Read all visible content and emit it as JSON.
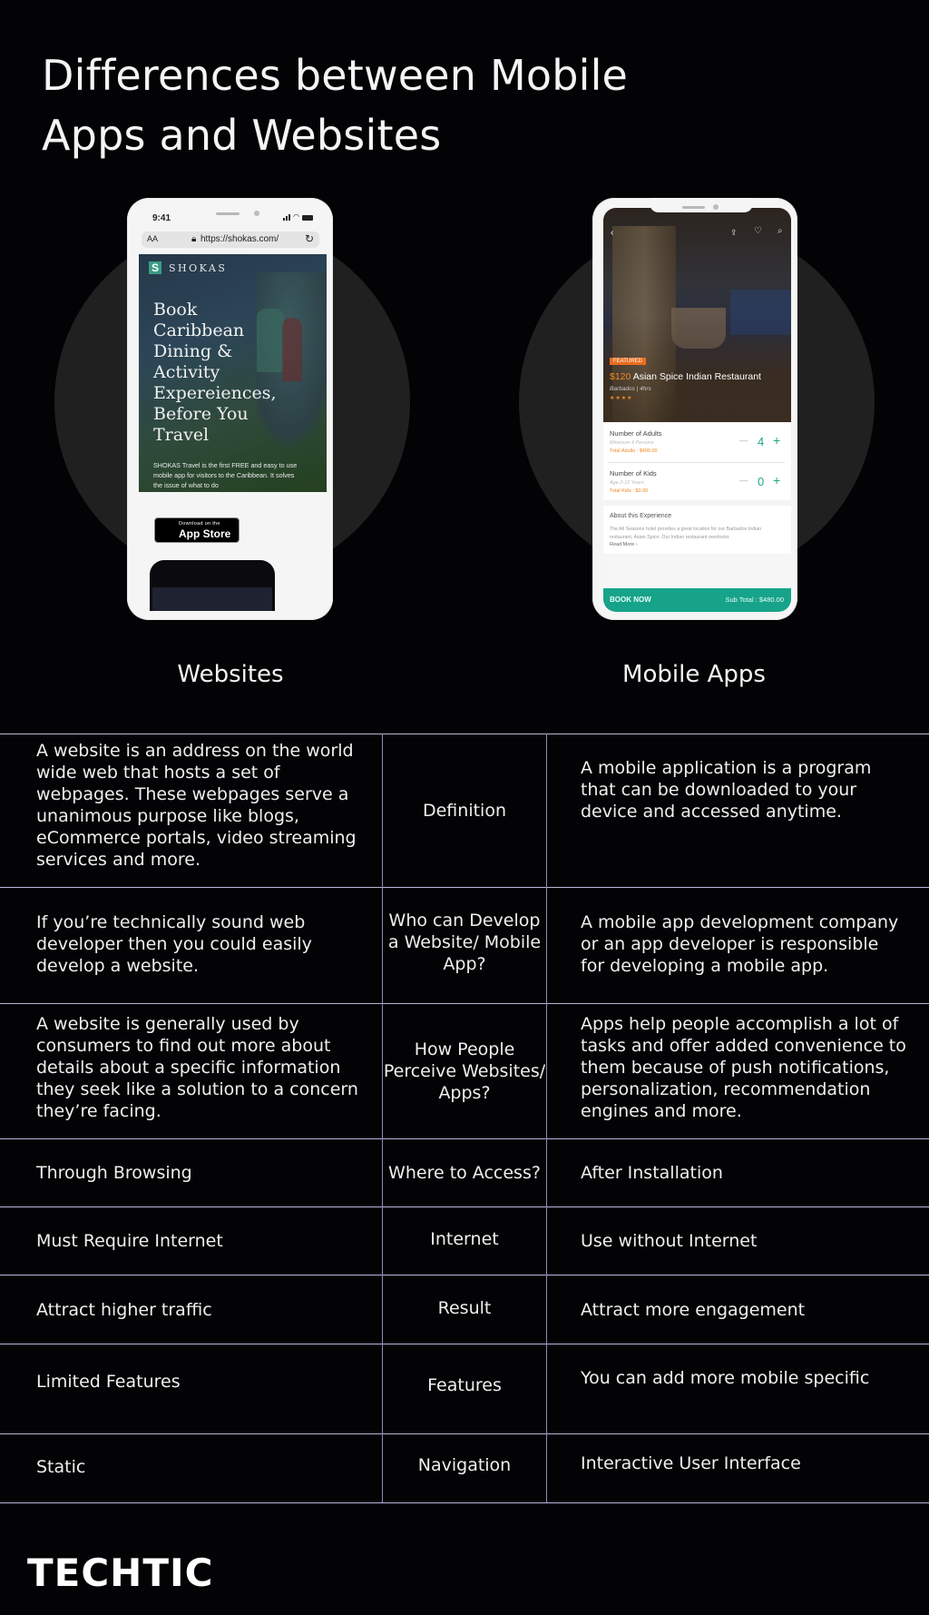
{
  "title": {
    "line1": "Differences between Mobile",
    "line2": "Apps and Websites"
  },
  "website_phone": {
    "time": "9:41",
    "text_size_label": "AA",
    "url": "https://shokas.com/",
    "brand": "SHOKAS",
    "brand_letter": "S",
    "headline_lines": [
      "Book",
      "Caribbean",
      "Dining &",
      "Activity",
      "Expereiences,",
      "Before You",
      "Travel"
    ],
    "description": "SHOKAS Travel is the first FREE and easy to use mobile app for visitors to the Caribbean. It solves the issue of what to do",
    "app_store_small": "Download on the",
    "app_store_big": "App Store"
  },
  "app_phone": {
    "badge": "FEATURED",
    "price": "$120",
    "restaurant": "Asian Spice Indian Restaurant",
    "location": "Barbados",
    "duration": "4hrs",
    "rating_stars": 4,
    "adults": {
      "label": "Number of Adults",
      "sub": "Minimum 4 Persons",
      "total": "Total Adults : $480.00",
      "value": "4"
    },
    "kids": {
      "label": "Number of Kids",
      "sub": "Age 2-12 Years",
      "total": "Total Kids : $0.00",
      "value": "0"
    },
    "about_title": "About this Experience",
    "about_text": "The All Seasons hotel provides a great location for our Barbados Indian restaurant, Asian Spice. Our Indian restaurant overlooks",
    "read_more": "Read More",
    "book_now": "BOOK NOW",
    "sub_total": "Sub Total : $480.00",
    "minus": "—",
    "plus": "+"
  },
  "columns": {
    "left": "Websites",
    "right": "Mobile Apps"
  },
  "rows": [
    {
      "website": "A website is an address on the world wide web that hosts a set of webpages. These webpages serve a unanimous purpose like blogs, eCommerce portals, video streaming services and more.",
      "aspect": "Definition",
      "app": "A mobile application is a program that can be downloaded to your device and accessed anytime."
    },
    {
      "website": "If you’re technically sound web developer then you could easily develop a website.",
      "aspect": "Who can Develop a Website/ Mobile App?",
      "app": "A mobile app development company or an app developer is responsible for developing a mobile app."
    },
    {
      "website": "A website is generally used by consumers to find out more about details about a specific information they seek like a solution to a concern they’re facing.",
      "aspect": "How People Perceive Websites/ Apps?",
      "app": "Apps help people accomplish a lot of tasks and offer added convenience to them because of push notifications, personalization, recommendation engines and more."
    },
    {
      "website": "Through Browsing",
      "aspect": "Where to Access?",
      "app": "After Installation"
    },
    {
      "website": "Must Require Internet",
      "aspect": "Internet",
      "app": "Use without Internet"
    },
    {
      "website": "Attract higher traffic",
      "aspect": "Result",
      "app": "Attract more engagement"
    },
    {
      "website": "Limited Features",
      "aspect": "Features",
      "app": "You can add more mobile specific"
    },
    {
      "website": "Static",
      "aspect": "Navigation",
      "app": "Interactive User Interface"
    }
  ],
  "logo": "TECHTIC",
  "colors": {
    "background": "#030305",
    "grid_line": "#b9b6d8",
    "teal": "#17a38a",
    "orange": "#ea6d1e"
  }
}
